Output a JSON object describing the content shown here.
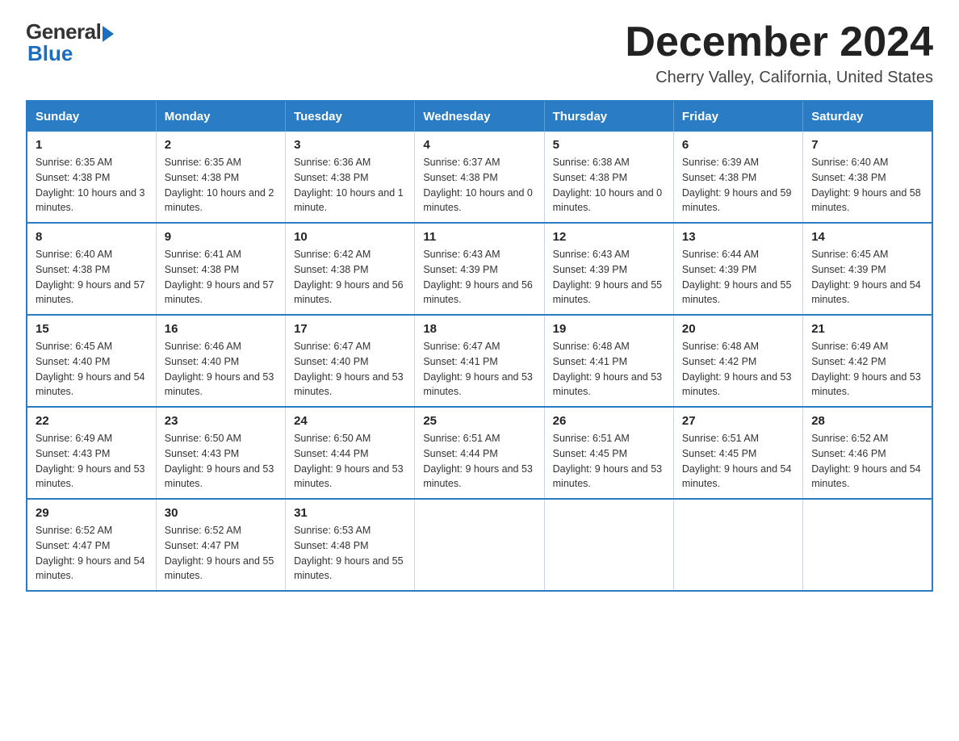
{
  "logo": {
    "general": "General",
    "blue": "Blue"
  },
  "title": {
    "month_year": "December 2024",
    "location": "Cherry Valley, California, United States"
  },
  "weekdays": [
    "Sunday",
    "Monday",
    "Tuesday",
    "Wednesday",
    "Thursday",
    "Friday",
    "Saturday"
  ],
  "weeks": [
    [
      {
        "day": "1",
        "sunrise": "6:35 AM",
        "sunset": "4:38 PM",
        "daylight": "10 hours and 3 minutes."
      },
      {
        "day": "2",
        "sunrise": "6:35 AM",
        "sunset": "4:38 PM",
        "daylight": "10 hours and 2 minutes."
      },
      {
        "day": "3",
        "sunrise": "6:36 AM",
        "sunset": "4:38 PM",
        "daylight": "10 hours and 1 minute."
      },
      {
        "day": "4",
        "sunrise": "6:37 AM",
        "sunset": "4:38 PM",
        "daylight": "10 hours and 0 minutes."
      },
      {
        "day": "5",
        "sunrise": "6:38 AM",
        "sunset": "4:38 PM",
        "daylight": "10 hours and 0 minutes."
      },
      {
        "day": "6",
        "sunrise": "6:39 AM",
        "sunset": "4:38 PM",
        "daylight": "9 hours and 59 minutes."
      },
      {
        "day": "7",
        "sunrise": "6:40 AM",
        "sunset": "4:38 PM",
        "daylight": "9 hours and 58 minutes."
      }
    ],
    [
      {
        "day": "8",
        "sunrise": "6:40 AM",
        "sunset": "4:38 PM",
        "daylight": "9 hours and 57 minutes."
      },
      {
        "day": "9",
        "sunrise": "6:41 AM",
        "sunset": "4:38 PM",
        "daylight": "9 hours and 57 minutes."
      },
      {
        "day": "10",
        "sunrise": "6:42 AM",
        "sunset": "4:38 PM",
        "daylight": "9 hours and 56 minutes."
      },
      {
        "day": "11",
        "sunrise": "6:43 AM",
        "sunset": "4:39 PM",
        "daylight": "9 hours and 56 minutes."
      },
      {
        "day": "12",
        "sunrise": "6:43 AM",
        "sunset": "4:39 PM",
        "daylight": "9 hours and 55 minutes."
      },
      {
        "day": "13",
        "sunrise": "6:44 AM",
        "sunset": "4:39 PM",
        "daylight": "9 hours and 55 minutes."
      },
      {
        "day": "14",
        "sunrise": "6:45 AM",
        "sunset": "4:39 PM",
        "daylight": "9 hours and 54 minutes."
      }
    ],
    [
      {
        "day": "15",
        "sunrise": "6:45 AM",
        "sunset": "4:40 PM",
        "daylight": "9 hours and 54 minutes."
      },
      {
        "day": "16",
        "sunrise": "6:46 AM",
        "sunset": "4:40 PM",
        "daylight": "9 hours and 53 minutes."
      },
      {
        "day": "17",
        "sunrise": "6:47 AM",
        "sunset": "4:40 PM",
        "daylight": "9 hours and 53 minutes."
      },
      {
        "day": "18",
        "sunrise": "6:47 AM",
        "sunset": "4:41 PM",
        "daylight": "9 hours and 53 minutes."
      },
      {
        "day": "19",
        "sunrise": "6:48 AM",
        "sunset": "4:41 PM",
        "daylight": "9 hours and 53 minutes."
      },
      {
        "day": "20",
        "sunrise": "6:48 AM",
        "sunset": "4:42 PM",
        "daylight": "9 hours and 53 minutes."
      },
      {
        "day": "21",
        "sunrise": "6:49 AM",
        "sunset": "4:42 PM",
        "daylight": "9 hours and 53 minutes."
      }
    ],
    [
      {
        "day": "22",
        "sunrise": "6:49 AM",
        "sunset": "4:43 PM",
        "daylight": "9 hours and 53 minutes."
      },
      {
        "day": "23",
        "sunrise": "6:50 AM",
        "sunset": "4:43 PM",
        "daylight": "9 hours and 53 minutes."
      },
      {
        "day": "24",
        "sunrise": "6:50 AM",
        "sunset": "4:44 PM",
        "daylight": "9 hours and 53 minutes."
      },
      {
        "day": "25",
        "sunrise": "6:51 AM",
        "sunset": "4:44 PM",
        "daylight": "9 hours and 53 minutes."
      },
      {
        "day": "26",
        "sunrise": "6:51 AM",
        "sunset": "4:45 PM",
        "daylight": "9 hours and 53 minutes."
      },
      {
        "day": "27",
        "sunrise": "6:51 AM",
        "sunset": "4:45 PM",
        "daylight": "9 hours and 54 minutes."
      },
      {
        "day": "28",
        "sunrise": "6:52 AM",
        "sunset": "4:46 PM",
        "daylight": "9 hours and 54 minutes."
      }
    ],
    [
      {
        "day": "29",
        "sunrise": "6:52 AM",
        "sunset": "4:47 PM",
        "daylight": "9 hours and 54 minutes."
      },
      {
        "day": "30",
        "sunrise": "6:52 AM",
        "sunset": "4:47 PM",
        "daylight": "9 hours and 55 minutes."
      },
      {
        "day": "31",
        "sunrise": "6:53 AM",
        "sunset": "4:48 PM",
        "daylight": "9 hours and 55 minutes."
      },
      null,
      null,
      null,
      null
    ]
  ],
  "labels": {
    "sunrise": "Sunrise:",
    "sunset": "Sunset:",
    "daylight": "Daylight:"
  }
}
